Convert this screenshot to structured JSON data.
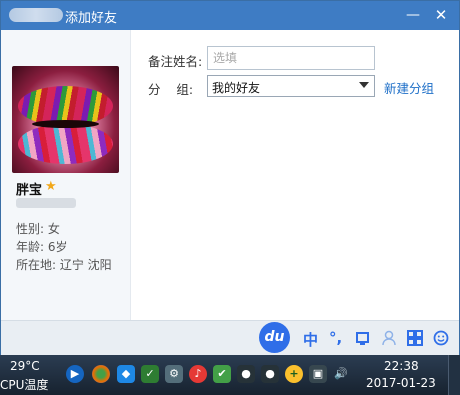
{
  "window": {
    "title": "添加好友",
    "minimize_symbol": "—",
    "close_symbol": "✕"
  },
  "profile": {
    "nickname": "胖宝",
    "gender": "性别: 女",
    "age": "年龄: 6岁",
    "location": "所在地: 辽宁  沈阳"
  },
  "form": {
    "remark_label": "备注姓名:",
    "remark_placeholder": "选填",
    "group_label": "分    组:",
    "group_value": "我的好友",
    "new_group_link": "新建分组"
  },
  "ime": {
    "du": "du",
    "lang": "中",
    "punct": "°,"
  },
  "taskbar": {
    "temperature": "29°C",
    "cpu_label": "CPU温度",
    "time": "22:38",
    "date": "2017-01-23"
  },
  "colors": {
    "titlebar": "#3e7cc4",
    "link": "#1e6fc8",
    "ime_blue": "#2f6ee8"
  }
}
